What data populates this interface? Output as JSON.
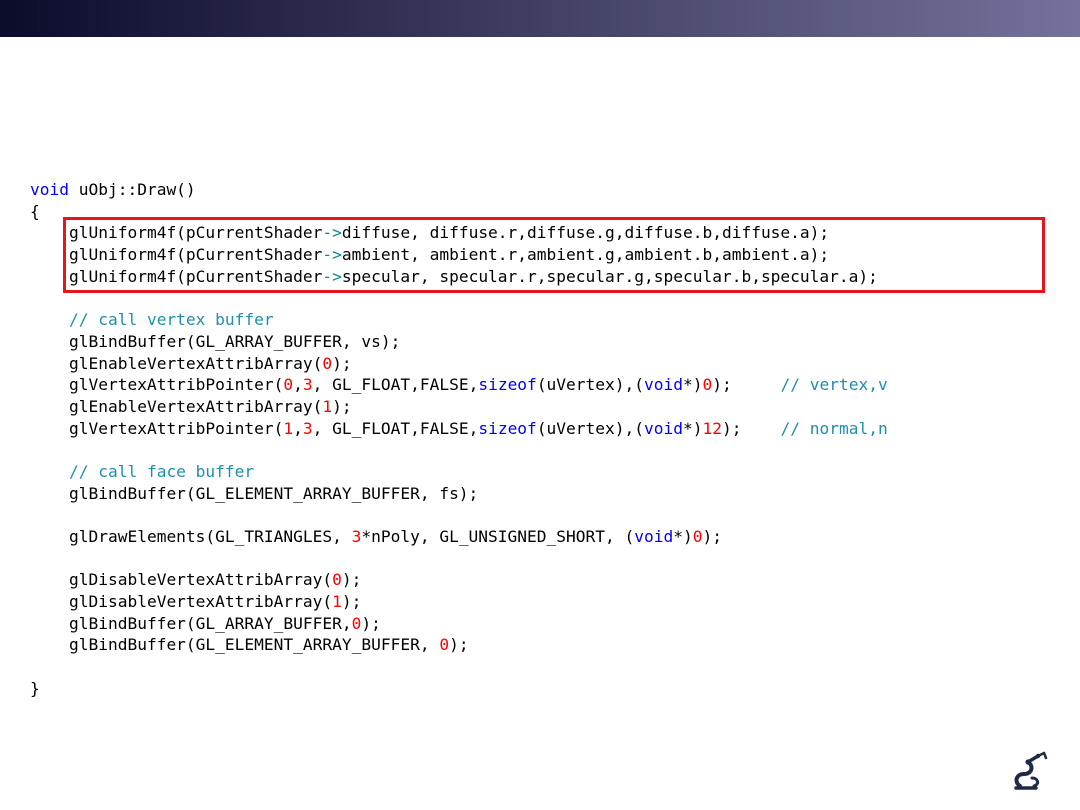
{
  "slide": {
    "bar_colors": {
      "start": "#0b0b2a",
      "mid": "#3b3a5e",
      "end": "#74729a"
    },
    "highlight_color": "#e8141c",
    "syntax_colors": {
      "keyword": "#0000ff",
      "number": "#ff0000",
      "comment": "#1e90a8",
      "arrow": "#008b8b"
    },
    "logo_icon": "robot-arm-logo-icon"
  },
  "code": {
    "lines": [
      [
        {
          "t": "void",
          "c": "kw"
        },
        {
          "t": " uObj::Draw()"
        }
      ],
      [
        {
          "t": "{"
        }
      ],
      [
        {
          "t": "    glUniform4f(pCurrentShader"
        },
        {
          "t": "->",
          "c": "op"
        },
        {
          "t": "diffuse, diffuse.r,diffuse.g,diffuse.b,diffuse.a);"
        }
      ],
      [
        {
          "t": "    glUniform4f(pCurrentShader"
        },
        {
          "t": "->",
          "c": "op"
        },
        {
          "t": "ambient, ambient.r,ambient.g,ambient.b,ambient.a);"
        }
      ],
      [
        {
          "t": "    glUniform4f(pCurrentShader"
        },
        {
          "t": "->",
          "c": "op"
        },
        {
          "t": "specular, specular.r,specular.g,specular.b,specular.a);"
        }
      ],
      [
        {
          "t": ""
        }
      ],
      [
        {
          "t": "    "
        },
        {
          "t": "// call vertex buffer",
          "c": "cm"
        }
      ],
      [
        {
          "t": "    glBindBuffer(GL_ARRAY_BUFFER, vs);"
        }
      ],
      [
        {
          "t": "    glEnableVertexAttribArray("
        },
        {
          "t": "0",
          "c": "num"
        },
        {
          "t": ");"
        }
      ],
      [
        {
          "t": "    glVertexAttribPointer("
        },
        {
          "t": "0",
          "c": "num"
        },
        {
          "t": ","
        },
        {
          "t": "3",
          "c": "num"
        },
        {
          "t": ", GL_FLOAT,FALSE,"
        },
        {
          "t": "sizeof",
          "c": "kw"
        },
        {
          "t": "(uVertex),("
        },
        {
          "t": "void",
          "c": "kw"
        },
        {
          "t": "*)"
        },
        {
          "t": "0",
          "c": "num"
        },
        {
          "t": ");     "
        },
        {
          "t": "// vertex,v",
          "c": "cm"
        }
      ],
      [
        {
          "t": "    glEnableVertexAttribArray("
        },
        {
          "t": "1",
          "c": "num"
        },
        {
          "t": ");"
        }
      ],
      [
        {
          "t": "    glVertexAttribPointer("
        },
        {
          "t": "1",
          "c": "num"
        },
        {
          "t": ","
        },
        {
          "t": "3",
          "c": "num"
        },
        {
          "t": ", GL_FLOAT,FALSE,"
        },
        {
          "t": "sizeof",
          "c": "kw"
        },
        {
          "t": "(uVertex),("
        },
        {
          "t": "void",
          "c": "kw"
        },
        {
          "t": "*)"
        },
        {
          "t": "12",
          "c": "num"
        },
        {
          "t": ");    "
        },
        {
          "t": "// normal,n",
          "c": "cm"
        }
      ],
      [
        {
          "t": ""
        }
      ],
      [
        {
          "t": "    "
        },
        {
          "t": "// call face buffer",
          "c": "cm"
        }
      ],
      [
        {
          "t": "    glBindBuffer(GL_ELEMENT_ARRAY_BUFFER, fs);"
        }
      ],
      [
        {
          "t": ""
        }
      ],
      [
        {
          "t": "    glDrawElements(GL_TRIANGLES, "
        },
        {
          "t": "3",
          "c": "num"
        },
        {
          "t": "*nPoly, GL_UNSIGNED_SHORT, ("
        },
        {
          "t": "void",
          "c": "kw"
        },
        {
          "t": "*)"
        },
        {
          "t": "0",
          "c": "num"
        },
        {
          "t": ");"
        }
      ],
      [
        {
          "t": ""
        }
      ],
      [
        {
          "t": "    glDisableVertexAttribArray("
        },
        {
          "t": "0",
          "c": "num"
        },
        {
          "t": ");"
        }
      ],
      [
        {
          "t": "    glDisableVertexAttribArray("
        },
        {
          "t": "1",
          "c": "num"
        },
        {
          "t": ");"
        }
      ],
      [
        {
          "t": "    glBindBuffer(GL_ARRAY_BUFFER,"
        },
        {
          "t": "0",
          "c": "num"
        },
        {
          "t": ");"
        }
      ],
      [
        {
          "t": "    glBindBuffer(GL_ELEMENT_ARRAY_BUFFER, "
        },
        {
          "t": "0",
          "c": "num"
        },
        {
          "t": ");"
        }
      ],
      [
        {
          "t": ""
        }
      ],
      [
        {
          "t": "}"
        }
      ]
    ]
  }
}
